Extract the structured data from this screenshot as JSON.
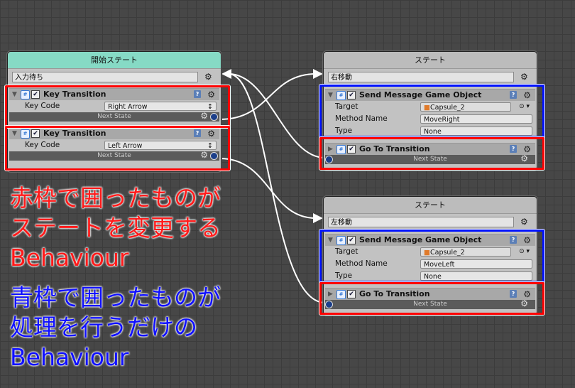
{
  "start_node": {
    "title": "開始ステート",
    "name": "入力待ち",
    "behaviours": [
      {
        "title": "Key Transition",
        "prop_label": "Key Code",
        "prop_value": "Right Arrow",
        "footer": "Next State"
      },
      {
        "title": "Key Transition",
        "prop_label": "Key Code",
        "prop_value": "Left Arrow",
        "footer": "Next State"
      }
    ]
  },
  "nodes": [
    {
      "title": "ステート",
      "name": "右移動",
      "send": {
        "title": "Send Message Game Object",
        "target_label": "Target",
        "target_value": "Capsule_2",
        "method_label": "Method Name",
        "method_value": "MoveRight",
        "type_label": "Type",
        "type_value": "None"
      },
      "goto": {
        "title": "Go To Transition",
        "footer": "Next State"
      }
    },
    {
      "title": "ステート",
      "name": "左移動",
      "send": {
        "title": "Send Message Game Object",
        "target_label": "Target",
        "target_value": "Capsule_2",
        "method_label": "Method Name",
        "method_value": "MoveLeft",
        "type_label": "Type",
        "type_value": "None"
      },
      "goto": {
        "title": "Go To Transition",
        "footer": "Next State"
      }
    }
  ],
  "annotations": {
    "red_lines": [
      "赤枠で囲ったものが",
      "ステートを変更する",
      "Behaviour"
    ],
    "blue_lines": [
      "青枠で囲ったものが",
      "処理を行うだけの",
      "Behaviour"
    ],
    "red_color": "#ff1a1a",
    "blue_color": "#1010ff"
  }
}
